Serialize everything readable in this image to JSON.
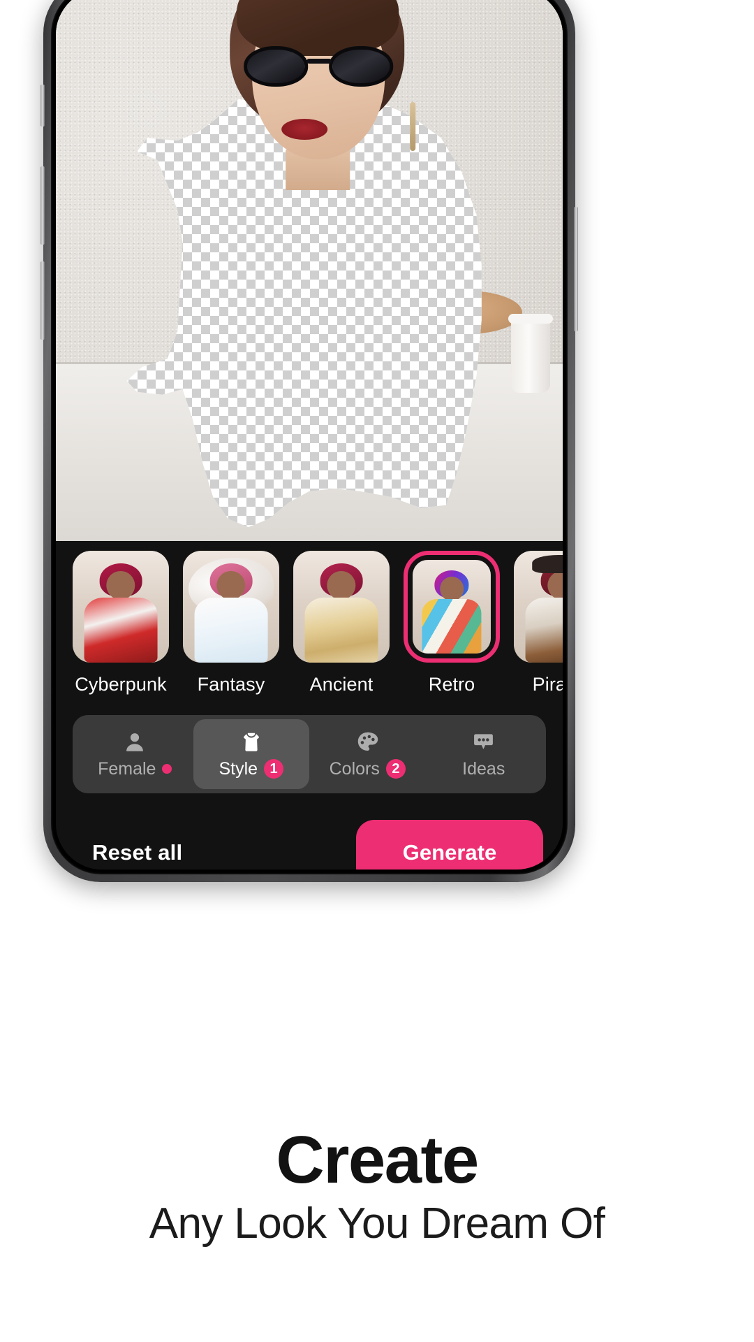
{
  "app": {
    "accent_color": "#ED2E72",
    "panel_bg": "#121212",
    "tabbar_bg": "#3A3A3A",
    "tab_active_bg": "#575757"
  },
  "canvas": {
    "name": "photo-canvas",
    "description": "Portrait photo of a woman in sunglasses with her outfit removed, showing transparency checkerboard"
  },
  "styles": {
    "section_name": "style-carousel",
    "items": [
      {
        "label": "Cyberpunk",
        "selected": false
      },
      {
        "label": "Fantasy",
        "selected": false
      },
      {
        "label": "Ancient",
        "selected": false
      },
      {
        "label": "Retro",
        "selected": true
      },
      {
        "label": "Pirates",
        "selected": false
      }
    ]
  },
  "tabs": [
    {
      "label": "Female",
      "icon": "person-icon",
      "badge": "",
      "dot": true,
      "active": false
    },
    {
      "label": "Style",
      "icon": "tshirt-icon",
      "badge": "1",
      "dot": false,
      "active": true
    },
    {
      "label": "Colors",
      "icon": "palette-icon",
      "badge": "2",
      "dot": false,
      "active": false
    },
    {
      "label": "Ideas",
      "icon": "speech-bubble-icon",
      "badge": "",
      "dot": false,
      "active": false
    }
  ],
  "actions": {
    "reset_label": "Reset all",
    "generate_label": "Generate"
  },
  "marketing": {
    "headline": "Create",
    "subheadline": "Any Look You Dream Of"
  }
}
